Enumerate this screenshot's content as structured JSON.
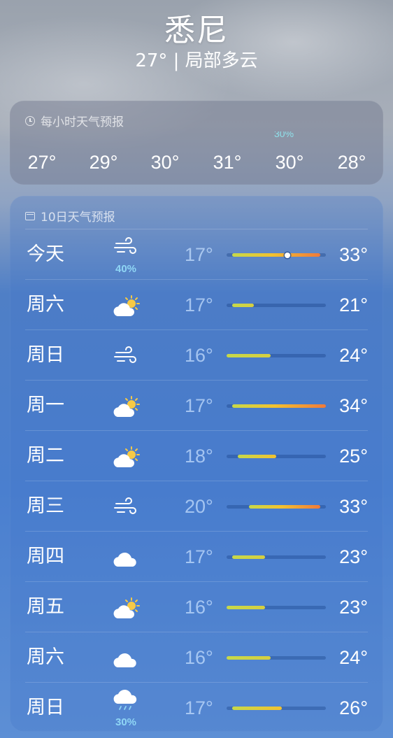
{
  "header": {
    "city": "悉尼",
    "summary": "27° | 局部多云"
  },
  "hourly": {
    "title": "每小时天气预报",
    "icon": "clock-icon",
    "partial_precip": "30%",
    "temps": [
      "27°",
      "29°",
      "30°",
      "31°",
      "30°",
      "28°"
    ]
  },
  "daily": {
    "title": "10日天气预报",
    "icon": "calendar-icon",
    "range_min": 16,
    "range_max": 34,
    "current_temp": 27,
    "colors": {
      "cool": "#c6d94a",
      "warm": "#f2c230",
      "hot": "#f07a3a"
    },
    "days": [
      {
        "day": "今天",
        "icon": "wind-icon",
        "precip": "40%",
        "low": "17°",
        "high": "33°",
        "low_v": 17,
        "high_v": 33
      },
      {
        "day": "周六",
        "icon": "partly-sunny-icon",
        "precip": "",
        "low": "17°",
        "high": "21°",
        "low_v": 17,
        "high_v": 21
      },
      {
        "day": "周日",
        "icon": "wind-icon",
        "precip": "",
        "low": "16°",
        "high": "24°",
        "low_v": 16,
        "high_v": 24
      },
      {
        "day": "周一",
        "icon": "partly-sunny-icon",
        "precip": "",
        "low": "17°",
        "high": "34°",
        "low_v": 17,
        "high_v": 34
      },
      {
        "day": "周二",
        "icon": "partly-sunny-icon",
        "precip": "",
        "low": "18°",
        "high": "25°",
        "low_v": 18,
        "high_v": 25
      },
      {
        "day": "周三",
        "icon": "wind-icon",
        "precip": "",
        "low": "20°",
        "high": "33°",
        "low_v": 20,
        "high_v": 33
      },
      {
        "day": "周四",
        "icon": "cloud-icon",
        "precip": "",
        "low": "17°",
        "high": "23°",
        "low_v": 17,
        "high_v": 23
      },
      {
        "day": "周五",
        "icon": "partly-sunny-icon",
        "precip": "",
        "low": "16°",
        "high": "23°",
        "low_v": 16,
        "high_v": 23
      },
      {
        "day": "周六",
        "icon": "cloud-icon",
        "precip": "",
        "low": "16°",
        "high": "24°",
        "low_v": 16,
        "high_v": 24
      },
      {
        "day": "周日",
        "icon": "rain-cloud-icon",
        "precip": "30%",
        "low": "17°",
        "high": "26°",
        "low_v": 17,
        "high_v": 26
      }
    ]
  }
}
